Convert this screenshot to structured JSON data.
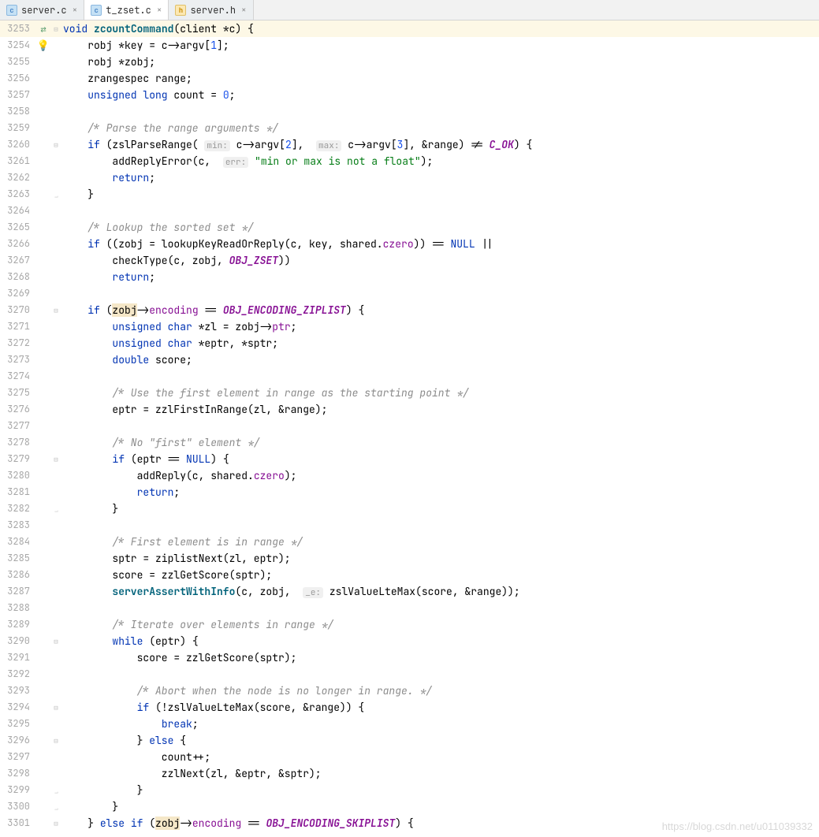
{
  "tabs": [
    {
      "icon": "c",
      "iconText": "c",
      "label": "server.c",
      "active": false
    },
    {
      "icon": "c",
      "iconText": "c",
      "label": "t_zset.c",
      "active": true
    },
    {
      "icon": "h",
      "iconText": "h",
      "label": "server.h",
      "active": false
    }
  ],
  "watermark": "https://blog.csdn.net/u011039332",
  "startLine": 3253,
  "code": [
    {
      "n": 3253,
      "marker": "swap",
      "fold": "def",
      "hl": true,
      "tokens": [
        [
          "kw",
          "void "
        ],
        [
          "fn",
          "zcountCommand"
        ],
        [
          "op",
          "("
        ],
        [
          "id",
          "client *c"
        ],
        [
          "op",
          ") {"
        ]
      ]
    },
    {
      "n": 3254,
      "marker": "bulb",
      "tokens": [
        [
          "id",
          "    robj *key = c->argv["
        ],
        [
          "num",
          "1"
        ],
        [
          "id",
          "];"
        ]
      ]
    },
    {
      "n": 3255,
      "tokens": [
        [
          "id",
          "    robj *zobj;"
        ]
      ]
    },
    {
      "n": 3256,
      "tokens": [
        [
          "id",
          "    zrangespec range;"
        ]
      ]
    },
    {
      "n": 3257,
      "tokens": [
        [
          "id",
          "    "
        ],
        [
          "kw",
          "unsigned long "
        ],
        [
          "id",
          "count = "
        ],
        [
          "num",
          "0"
        ],
        [
          "id",
          ";"
        ]
      ]
    },
    {
      "n": 3258,
      "tokens": []
    },
    {
      "n": 3259,
      "tokens": [
        [
          "id",
          "    "
        ],
        [
          "cmt",
          "/* Parse the range arguments */"
        ]
      ]
    },
    {
      "n": 3260,
      "fold": "open",
      "tokens": [
        [
          "id",
          "    "
        ],
        [
          "kw",
          "if "
        ],
        [
          "id",
          "(zslParseRange( "
        ],
        [
          "hint",
          "min:"
        ],
        [
          "id",
          " c->argv["
        ],
        [
          "num",
          "2"
        ],
        [
          "id",
          "],  "
        ],
        [
          "hint",
          "max:"
        ],
        [
          "id",
          " c->argv["
        ],
        [
          "num",
          "3"
        ],
        [
          "id",
          "], &range) != "
        ],
        [
          "con",
          "C_OK"
        ],
        [
          "id",
          ") {"
        ]
      ]
    },
    {
      "n": 3261,
      "tokens": [
        [
          "id",
          "        addReplyError(c,  "
        ],
        [
          "hint",
          "err:"
        ],
        [
          "id",
          " "
        ],
        [
          "str",
          "\"min or max is not a float\""
        ],
        [
          "id",
          ");"
        ]
      ]
    },
    {
      "n": 3262,
      "tokens": [
        [
          "id",
          "        "
        ],
        [
          "kw",
          "return"
        ],
        [
          "id",
          ";"
        ]
      ]
    },
    {
      "n": 3263,
      "fold": "end",
      "tokens": [
        [
          "id",
          "    }"
        ]
      ]
    },
    {
      "n": 3264,
      "tokens": []
    },
    {
      "n": 3265,
      "tokens": [
        [
          "id",
          "    "
        ],
        [
          "cmt",
          "/* Lookup the sorted set */"
        ]
      ]
    },
    {
      "n": 3266,
      "tokens": [
        [
          "id",
          "    "
        ],
        [
          "kw",
          "if "
        ],
        [
          "id",
          "((zobj = lookupKeyReadOrReply(c, key, shared."
        ],
        [
          "mem",
          "czero"
        ],
        [
          "id",
          ")) == "
        ],
        [
          "kw",
          "NULL"
        ],
        [
          "id",
          " ||"
        ]
      ]
    },
    {
      "n": 3267,
      "tokens": [
        [
          "id",
          "        checkType(c, zobj, "
        ],
        [
          "con",
          "OBJ_ZSET"
        ],
        [
          "id",
          "))"
        ]
      ]
    },
    {
      "n": 3268,
      "tokens": [
        [
          "id",
          "        "
        ],
        [
          "kw",
          "return"
        ],
        [
          "id",
          ";"
        ]
      ]
    },
    {
      "n": 3269,
      "tokens": []
    },
    {
      "n": 3270,
      "fold": "open",
      "tokens": [
        [
          "id",
          "    "
        ],
        [
          "kw",
          "if "
        ],
        [
          "id",
          "("
        ],
        [
          "hl",
          "zobj"
        ],
        [
          "id",
          "->"
        ],
        [
          "mem",
          "encoding"
        ],
        [
          "id",
          " == "
        ],
        [
          "con",
          "OBJ_ENCODING_ZIPLIST"
        ],
        [
          "id",
          ") {"
        ]
      ]
    },
    {
      "n": 3271,
      "tokens": [
        [
          "id",
          "        "
        ],
        [
          "kw",
          "unsigned char "
        ],
        [
          "id",
          "*zl = zobj->"
        ],
        [
          "mem",
          "ptr"
        ],
        [
          "id",
          ";"
        ]
      ]
    },
    {
      "n": 3272,
      "tokens": [
        [
          "id",
          "        "
        ],
        [
          "kw",
          "unsigned char "
        ],
        [
          "id",
          "*eptr, *sptr;"
        ]
      ]
    },
    {
      "n": 3273,
      "tokens": [
        [
          "id",
          "        "
        ],
        [
          "kw",
          "double "
        ],
        [
          "id",
          "score;"
        ]
      ]
    },
    {
      "n": 3274,
      "tokens": []
    },
    {
      "n": 3275,
      "tokens": [
        [
          "id",
          "        "
        ],
        [
          "cmt",
          "/* Use the first element in range as the starting point */"
        ]
      ]
    },
    {
      "n": 3276,
      "tokens": [
        [
          "id",
          "        eptr = zzlFirstInRange(zl, &range);"
        ]
      ]
    },
    {
      "n": 3277,
      "tokens": []
    },
    {
      "n": 3278,
      "tokens": [
        [
          "id",
          "        "
        ],
        [
          "cmt",
          "/* No \"first\" element */"
        ]
      ]
    },
    {
      "n": 3279,
      "fold": "open",
      "tokens": [
        [
          "id",
          "        "
        ],
        [
          "kw",
          "if "
        ],
        [
          "id",
          "(eptr == "
        ],
        [
          "kw",
          "NULL"
        ],
        [
          "id",
          ") {"
        ]
      ]
    },
    {
      "n": 3280,
      "tokens": [
        [
          "id",
          "            addReply(c, shared."
        ],
        [
          "mem",
          "czero"
        ],
        [
          "id",
          ");"
        ]
      ]
    },
    {
      "n": 3281,
      "tokens": [
        [
          "id",
          "            "
        ],
        [
          "kw",
          "return"
        ],
        [
          "id",
          ";"
        ]
      ]
    },
    {
      "n": 3282,
      "fold": "end",
      "tokens": [
        [
          "id",
          "        }"
        ]
      ]
    },
    {
      "n": 3283,
      "tokens": []
    },
    {
      "n": 3284,
      "tokens": [
        [
          "id",
          "        "
        ],
        [
          "cmt",
          "/* First element is in range */"
        ]
      ]
    },
    {
      "n": 3285,
      "tokens": [
        [
          "id",
          "        sptr = ziplistNext(zl, eptr);"
        ]
      ]
    },
    {
      "n": 3286,
      "tokens": [
        [
          "id",
          "        score = zzlGetScore(sptr);"
        ]
      ]
    },
    {
      "n": 3287,
      "tokens": [
        [
          "id",
          "        "
        ],
        [
          "fn",
          "serverAssertWithInfo"
        ],
        [
          "id",
          "(c, zobj,  "
        ],
        [
          "hint",
          "_e:"
        ],
        [
          "id",
          " zslValueLteMax(score, &range));"
        ]
      ]
    },
    {
      "n": 3288,
      "tokens": []
    },
    {
      "n": 3289,
      "tokens": [
        [
          "id",
          "        "
        ],
        [
          "cmt",
          "/* Iterate over elements in range */"
        ]
      ]
    },
    {
      "n": 3290,
      "fold": "open",
      "tokens": [
        [
          "id",
          "        "
        ],
        [
          "kw",
          "while "
        ],
        [
          "id",
          "(eptr) {"
        ]
      ]
    },
    {
      "n": 3291,
      "tokens": [
        [
          "id",
          "            score = zzlGetScore(sptr);"
        ]
      ]
    },
    {
      "n": 3292,
      "tokens": []
    },
    {
      "n": 3293,
      "tokens": [
        [
          "id",
          "            "
        ],
        [
          "cmt",
          "/* Abort when the node is no longer in range. */"
        ]
      ]
    },
    {
      "n": 3294,
      "fold": "open",
      "tokens": [
        [
          "id",
          "            "
        ],
        [
          "kw",
          "if "
        ],
        [
          "id",
          "(!zslValueLteMax(score, &range)) {"
        ]
      ]
    },
    {
      "n": 3295,
      "tokens": [
        [
          "id",
          "                "
        ],
        [
          "kw",
          "break"
        ],
        [
          "id",
          ";"
        ]
      ]
    },
    {
      "n": 3296,
      "fold": "open",
      "tokens": [
        [
          "id",
          "            } "
        ],
        [
          "kw",
          "else"
        ],
        [
          "id",
          " {"
        ]
      ]
    },
    {
      "n": 3297,
      "tokens": [
        [
          "id",
          "                count++;"
        ]
      ]
    },
    {
      "n": 3298,
      "tokens": [
        [
          "id",
          "                zzlNext(zl, &eptr, &sptr);"
        ]
      ]
    },
    {
      "n": 3299,
      "fold": "end",
      "tokens": [
        [
          "id",
          "            }"
        ]
      ]
    },
    {
      "n": 3300,
      "fold": "end",
      "tokens": [
        [
          "id",
          "        }"
        ]
      ]
    },
    {
      "n": 3301,
      "fold": "open",
      "tokens": [
        [
          "id",
          "    } "
        ],
        [
          "kw",
          "else if "
        ],
        [
          "id",
          "("
        ],
        [
          "hl",
          "zobj"
        ],
        [
          "id",
          "->"
        ],
        [
          "mem",
          "encoding"
        ],
        [
          "id",
          " == "
        ],
        [
          "con",
          "OBJ_ENCODING_SKIPLIST"
        ],
        [
          "id",
          ") {"
        ]
      ]
    }
  ]
}
